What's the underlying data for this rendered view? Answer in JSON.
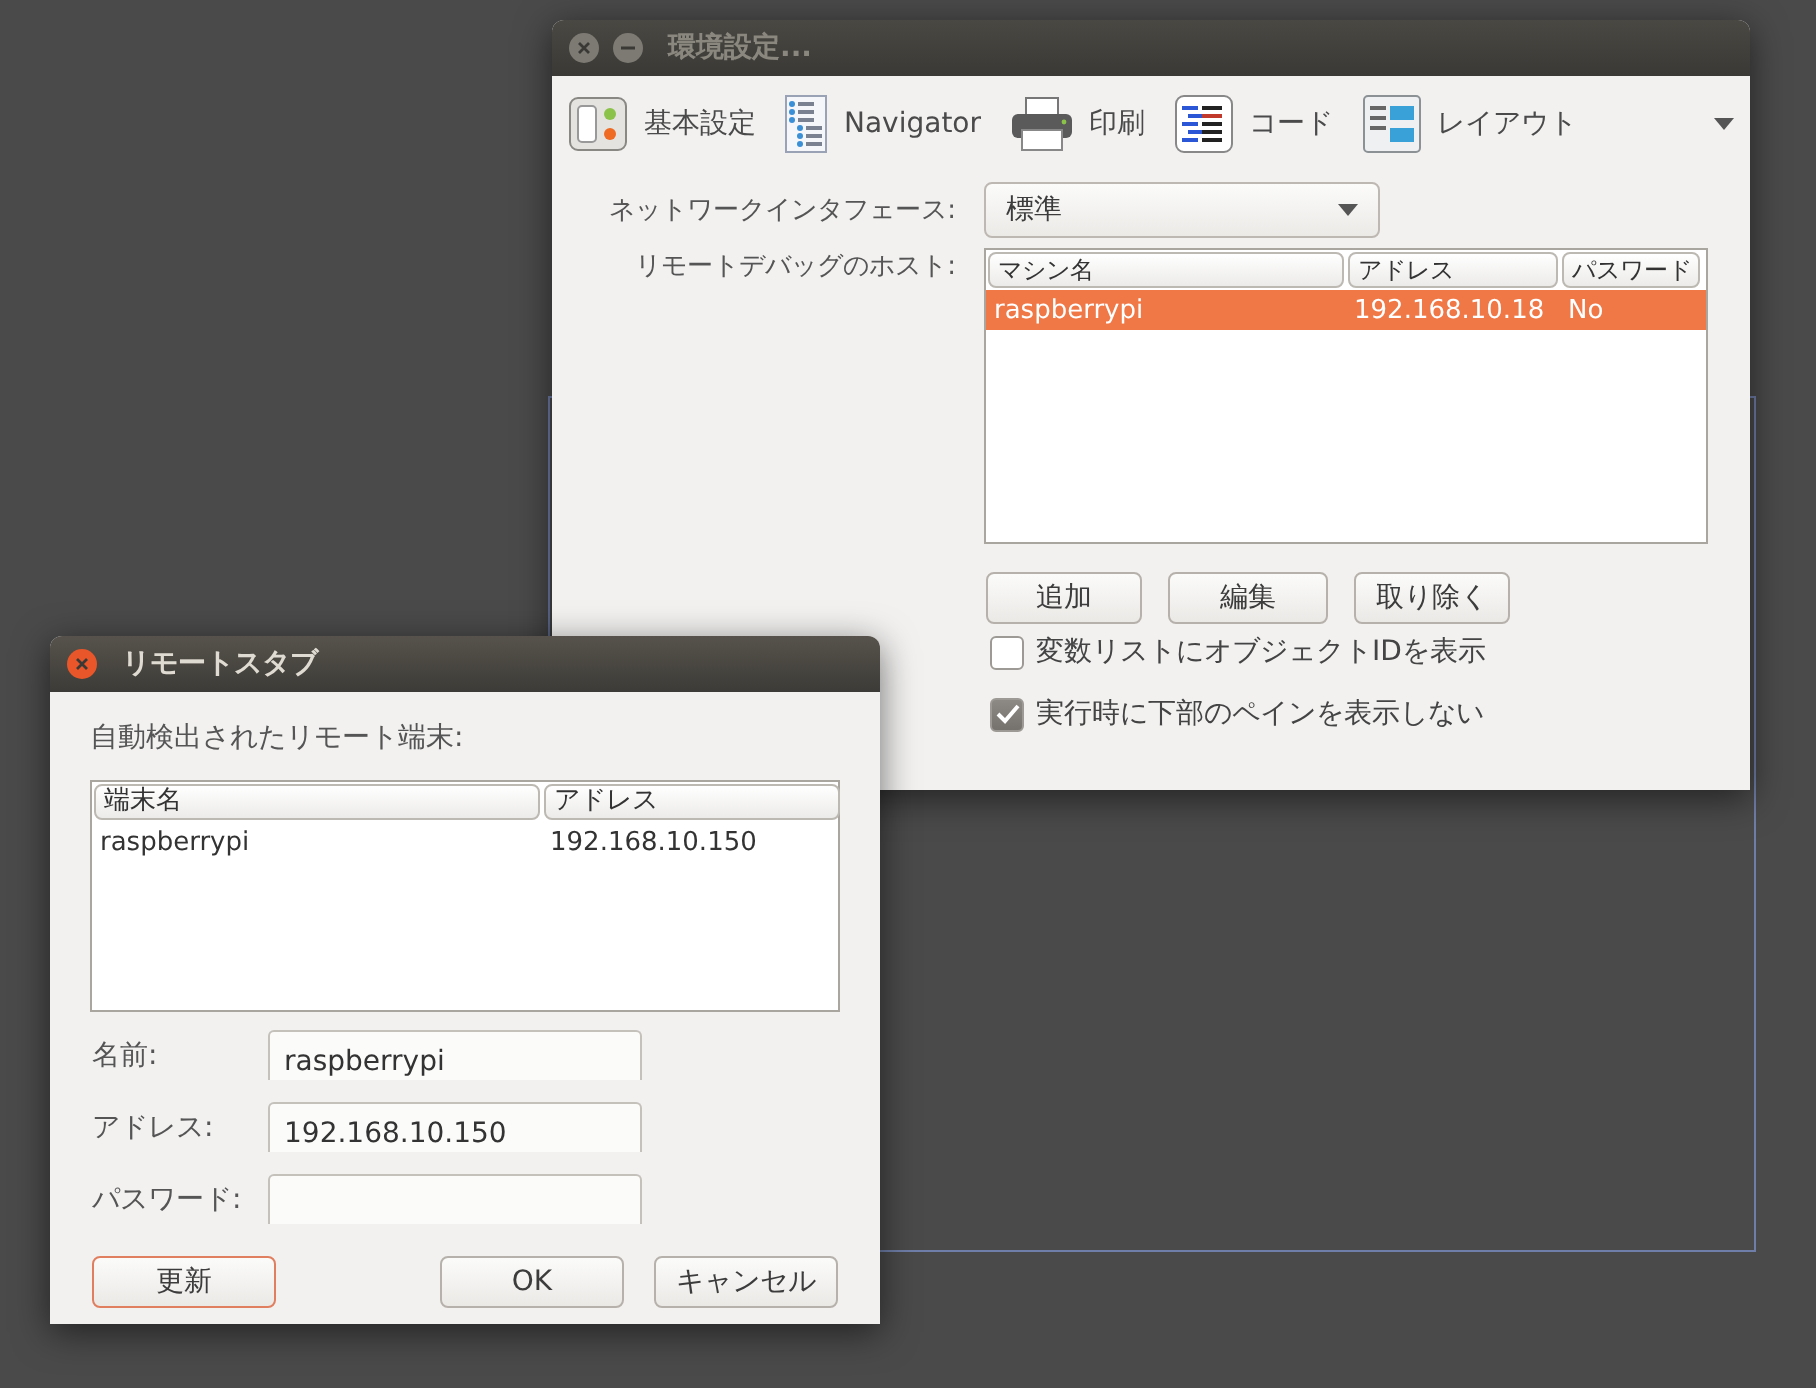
{
  "preferences_window": {
    "title": "環境設定...",
    "toolbar": [
      {
        "label": "基本設定",
        "kind": "general"
      },
      {
        "label": "Navigator",
        "kind": "navigator"
      },
      {
        "label": "印刷",
        "kind": "print"
      },
      {
        "label": "コード",
        "kind": "code"
      },
      {
        "label": "レイアウト",
        "kind": "layout"
      }
    ],
    "network_interface": {
      "label": "ネットワークインタフェース:",
      "value": "標準"
    },
    "remote_hosts": {
      "label": "リモートデバッグのホスト:",
      "columns": [
        "マシン名",
        "アドレス",
        "パスワード"
      ],
      "rows": [
        {
          "cells": [
            "raspberrypi",
            "192.168.10.18",
            "No"
          ],
          "selected": true
        }
      ]
    },
    "buttons": [
      "追加",
      "編集",
      "取り除く"
    ],
    "options": [
      {
        "label": "変数リストにオブジェクトIDを表示",
        "checked": false
      },
      {
        "label": "実行時に下部のペインを表示しない",
        "checked": true
      }
    ]
  },
  "remote_stub_dialog": {
    "title": "リモートスタブ",
    "list_label": "自動検出されたリモート端末:",
    "columns": [
      "端末名",
      "アドレス"
    ],
    "rows": [
      {
        "cells": [
          "raspberrypi",
          "192.168.10.150"
        ],
        "selected": false
      }
    ],
    "fields": [
      {
        "label": "名前:",
        "value": "raspberrypi"
      },
      {
        "label": "アドレス:",
        "value": "192.168.10.150"
      },
      {
        "label": "パスワード:"
      }
    ],
    "buttons": [
      {
        "label": "更新",
        "focused": true
      },
      {
        "label": "OK",
        "focused": false
      },
      {
        "label": "キャンセル",
        "focused": false
      }
    ]
  }
}
